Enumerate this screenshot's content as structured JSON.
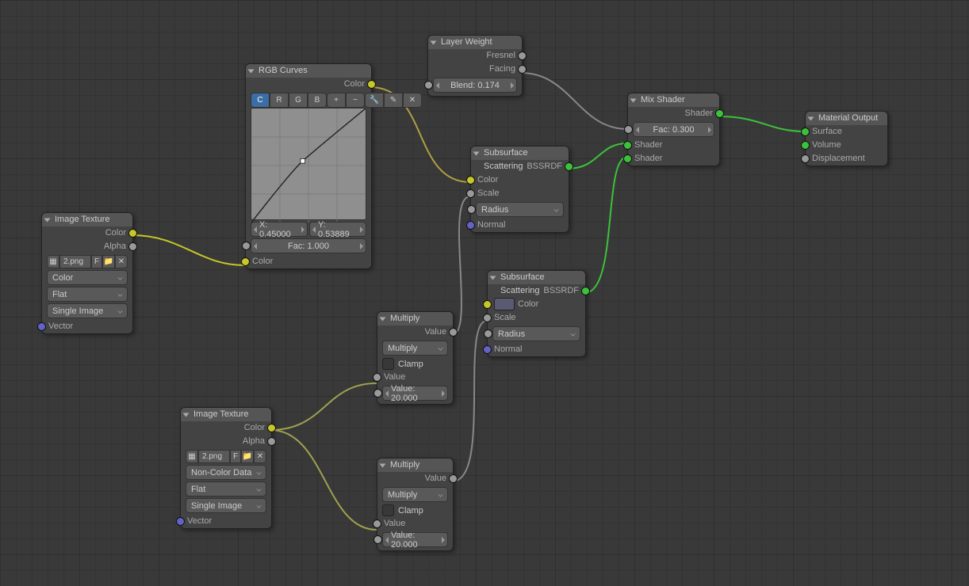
{
  "nodes": {
    "imgTex1": {
      "title": "Image Texture",
      "color": "Color",
      "alpha": "Alpha",
      "file": "2.png",
      "f": "F",
      "colorspace": "Color",
      "proj": "Flat",
      "interp": "Single Image",
      "vector": "Vector"
    },
    "imgTex2": {
      "title": "Image Texture",
      "color": "Color",
      "alpha": "Alpha",
      "file": "2.png",
      "f": "F",
      "colorspace": "Non-Color Data",
      "proj": "Flat",
      "interp": "Single Image",
      "vector": "Vector"
    },
    "rgb": {
      "title": "RGB Curves",
      "colorOut": "Color",
      "tabs": [
        "C",
        "R",
        "G",
        "B"
      ],
      "x": "X: 0.45000",
      "y": "Y: 0.53889",
      "fac": "Fac: 1.000",
      "colorIn": "Color"
    },
    "layer": {
      "title": "Layer Weight",
      "fresnel": "Fresnel",
      "facing": "Facing",
      "blend": "Blend: 0.174"
    },
    "mul1": {
      "title": "Multiply",
      "valOut": "Value",
      "mode": "Multiply",
      "clamp": "Clamp",
      "valIn": "Value",
      "valNum": "Value: 20.000"
    },
    "mul2": {
      "title": "Multiply",
      "valOut": "Value",
      "mode": "Multiply",
      "clamp": "Clamp",
      "valIn": "Value",
      "valNum": "Value: 20.000"
    },
    "sss1": {
      "title": "Subsurface Scattering",
      "out": "BSSRDF",
      "color": "Color",
      "scale": "Scale",
      "radius": "Radius",
      "normal": "Normal"
    },
    "sss2": {
      "title": "Subsurface Scattering",
      "out": "BSSRDF",
      "color": "Color",
      "scale": "Scale",
      "radius": "Radius",
      "normal": "Normal"
    },
    "mix": {
      "title": "Mix Shader",
      "out": "Shader",
      "fac": "Fac: 0.300",
      "s1": "Shader",
      "s2": "Shader"
    },
    "matOut": {
      "title": "Material Output",
      "surface": "Surface",
      "volume": "Volume",
      "disp": "Displacement"
    }
  }
}
